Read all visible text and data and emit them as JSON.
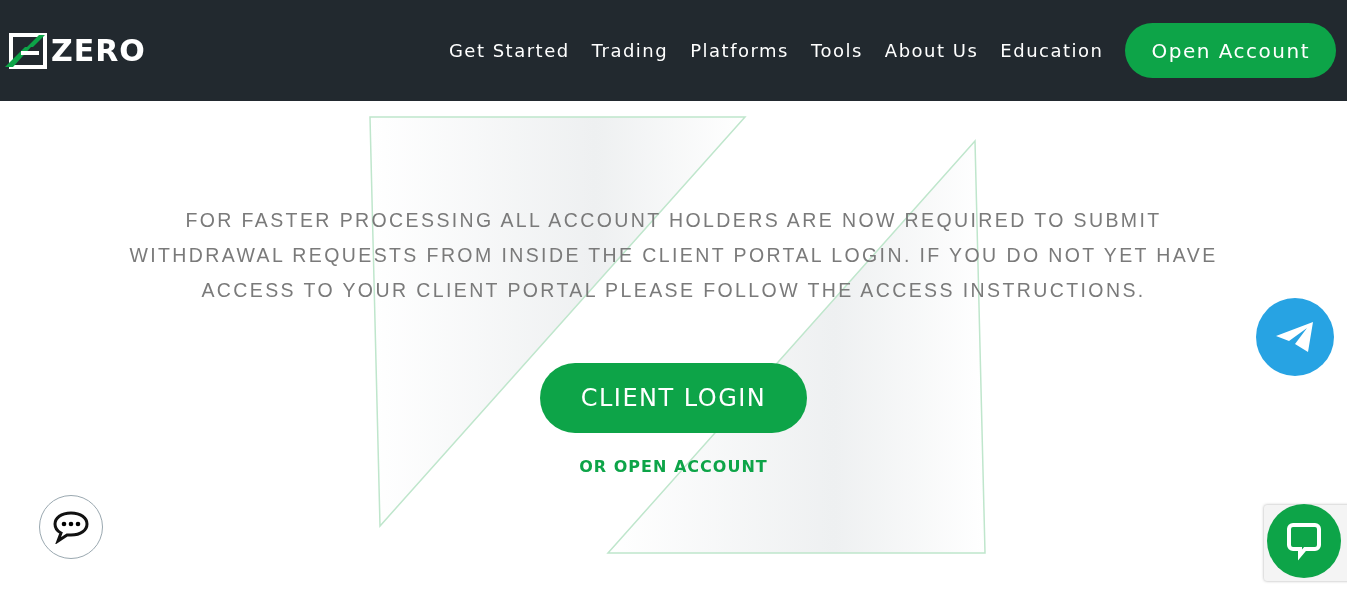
{
  "header": {
    "logo_text": "ZERO",
    "nav": [
      "Get Started",
      "Trading",
      "Platforms",
      "Tools",
      "About Us",
      "Education"
    ],
    "cta": "Open Account"
  },
  "notice": {
    "message": "FOR FASTER PROCESSING ALL ACCOUNT HOLDERS ARE NOW REQUIRED TO SUBMIT WITHDRAWAL REQUESTS FROM INSIDE THE CLIENT PORTAL LOGIN. IF YOU DO NOT YET HAVE ACCESS TO YOUR CLIENT PORTAL PLEASE FOLLOW THE ACCESS INSTRUCTIONS.",
    "button": "CLIENT LOGIN",
    "link": "OR OPEN ACCOUNT"
  }
}
